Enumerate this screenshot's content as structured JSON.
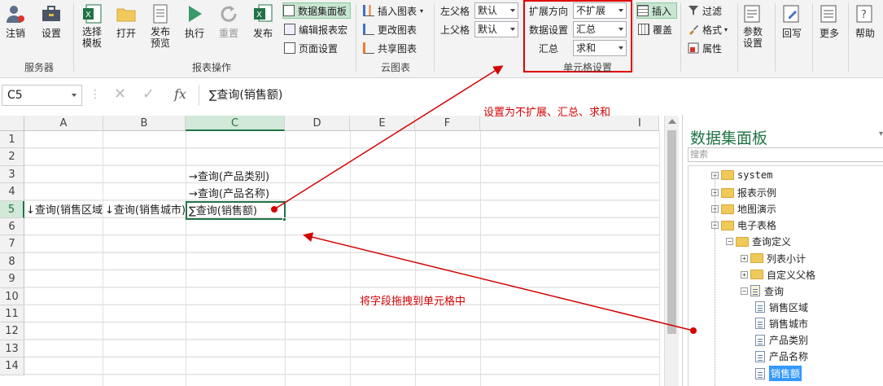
{
  "ribbon": {
    "groups": {
      "server": "服务器",
      "report_ops": "报表操作",
      "cloud_chart": "云图表",
      "cell_settings": "单元格设置"
    },
    "buttons": {
      "logout": "注销",
      "settings": "设置",
      "choose_template_1": "选择",
      "choose_template_2": "模板",
      "open": "打开",
      "publish_preview_1": "发布",
      "publish_preview_2": "预览",
      "execute": "执行",
      "reset": "重置",
      "publish": "发布",
      "dataset_panel": "数据集面板",
      "edit_macro": "编辑报表宏",
      "page_settings": "页面设置",
      "insert_chart": "插入图表",
      "update_chart": "更改图表",
      "share_chart": "共享图表",
      "insert": "插入",
      "overwrite": "覆盖",
      "filter": "过滤",
      "format": "格式",
      "properties": "属性",
      "param_settings_1": "参数",
      "param_settings_2": "设置",
      "writeback": "回写",
      "more": "更多",
      "help": "帮助"
    },
    "parent_cells": {
      "left_label": "左父格",
      "left_value": "默认",
      "top_label": "上父格",
      "top_value": "默认"
    },
    "cell_settings": {
      "expand_label": "扩展方向",
      "expand_value": "不扩展",
      "data_label": "数据设置",
      "data_value": "汇总",
      "agg_label": "汇总",
      "agg_value": "求和"
    }
  },
  "formula_bar": {
    "name_box": "C5",
    "fx": "fx",
    "content": "∑查询(销售额)"
  },
  "sheet": {
    "columns": [
      "A",
      "B",
      "C",
      "D",
      "E",
      "F",
      "I"
    ],
    "rows": [
      "1",
      "2",
      "3",
      "4",
      "5",
      "6",
      "7",
      "8",
      "9",
      "10",
      "11",
      "12",
      "13",
      "14"
    ],
    "cells": {
      "C3": "→查询(产品类别)",
      "C4": "→查询(产品名称)",
      "A5": "↓查询(销售区域)",
      "B5": "↓查询(销售城市)",
      "C5": "∑查询(销售额)"
    }
  },
  "panel": {
    "title": "数据集面板",
    "search_placeholder": "搜索",
    "tree": [
      {
        "label": "system",
        "level": 0,
        "type": "folder",
        "toggle": "+"
      },
      {
        "label": "报表示例",
        "level": 0,
        "type": "folder",
        "toggle": "+"
      },
      {
        "label": "地图演示",
        "level": 0,
        "type": "folder",
        "toggle": "+"
      },
      {
        "label": "电子表格",
        "level": 0,
        "type": "folder",
        "toggle": "−"
      },
      {
        "label": "查询定义",
        "level": 1,
        "type": "folder",
        "toggle": "−"
      },
      {
        "label": "列表小计",
        "level": 2,
        "type": "folder",
        "toggle": "+"
      },
      {
        "label": "自定义父格",
        "level": 2,
        "type": "folder",
        "toggle": "+"
      },
      {
        "label": "查询",
        "level": 2,
        "type": "query",
        "toggle": "−"
      },
      {
        "label": "销售区域",
        "level": 3,
        "type": "field"
      },
      {
        "label": "销售城市",
        "level": 3,
        "type": "field"
      },
      {
        "label": "产品类别",
        "level": 3,
        "type": "field"
      },
      {
        "label": "产品名称",
        "level": 3,
        "type": "field"
      },
      {
        "label": "销售额",
        "level": 3,
        "type": "field",
        "selected": true
      }
    ]
  },
  "annotations": {
    "top": "设置为不扩展、汇总、求和",
    "middle": "将字段拖拽到单元格中"
  },
  "colors": {
    "annotation": "#d40000",
    "selected_cell_border": "#217346",
    "selected_tree_item": "#3399ff"
  }
}
